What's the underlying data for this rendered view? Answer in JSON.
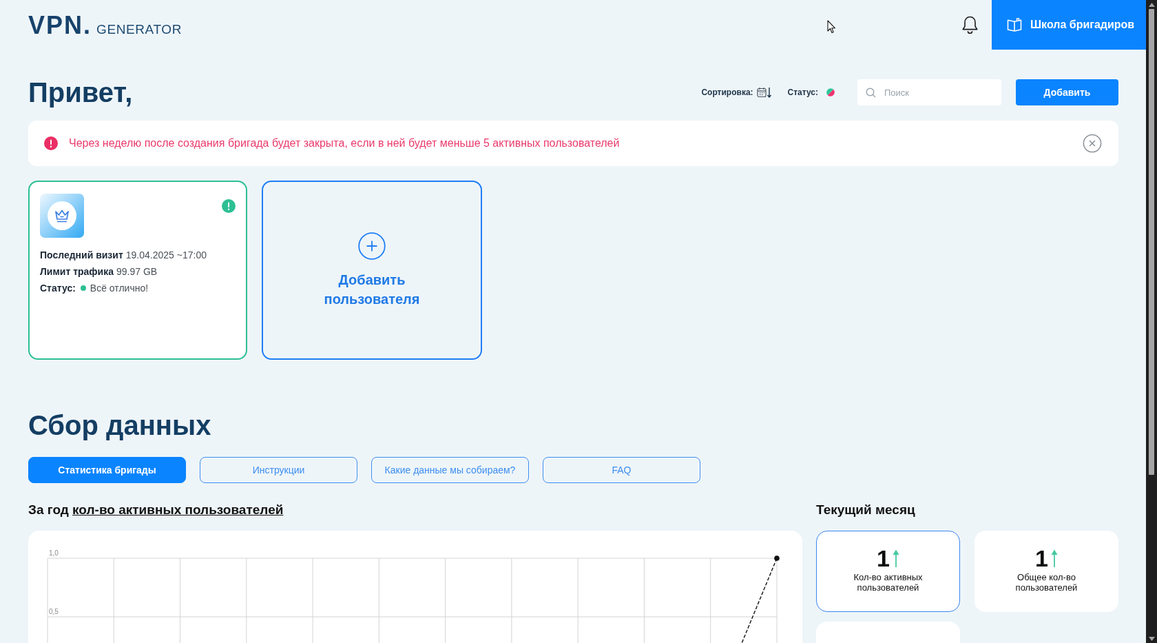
{
  "header": {
    "logo": {
      "mark": "VPN.",
      "wordmark": "GENERATOR"
    },
    "school_button": "Школа бригадиров"
  },
  "greeting": "Привет,",
  "toolbar": {
    "sort_label": "Сортировка:",
    "status_label": "Статус:",
    "search": {
      "placeholder": "Поиск"
    },
    "add_button": "Добавить"
  },
  "alert": {
    "text": "Через неделю после создания бригада будет закрыта, если в ней будет меньше 5 активных пользователей"
  },
  "users": [
    {
      "kind": "user",
      "fields": [
        {
          "label": "Последний визит",
          "value": "19.04.2025 ~17:00"
        },
        {
          "label": "Лимит трафика",
          "value": "99.97 GB"
        }
      ],
      "status": {
        "label": "Статус:",
        "text": "Всё отлично!",
        "color": "#2dbf94"
      }
    },
    {
      "kind": "add",
      "label": "Добавить пользователя"
    }
  ],
  "section_title": "Сбор данных",
  "tabs": [
    {
      "label": "Статистика бригады",
      "selected": true
    },
    {
      "label": "Инструкции",
      "selected": false
    },
    {
      "label": "Какие данные мы собираем?",
      "selected": false
    },
    {
      "label": "FAQ",
      "selected": false
    }
  ],
  "chart_heading": {
    "prefix": "За год",
    "link": "кол-во активных пользователей"
  },
  "chart": {
    "axis_labels": [
      "1,0",
      "0,5"
    ]
  },
  "month": {
    "title": "Текущий месяц",
    "stats": [
      {
        "value": "1",
        "rising": true,
        "label": "Кол-во активных пользователей",
        "selected": true
      },
      {
        "value": "1",
        "rising": true,
        "label": "Общее кол-во пользователей",
        "selected": false
      },
      {
        "selected": false
      }
    ]
  }
}
